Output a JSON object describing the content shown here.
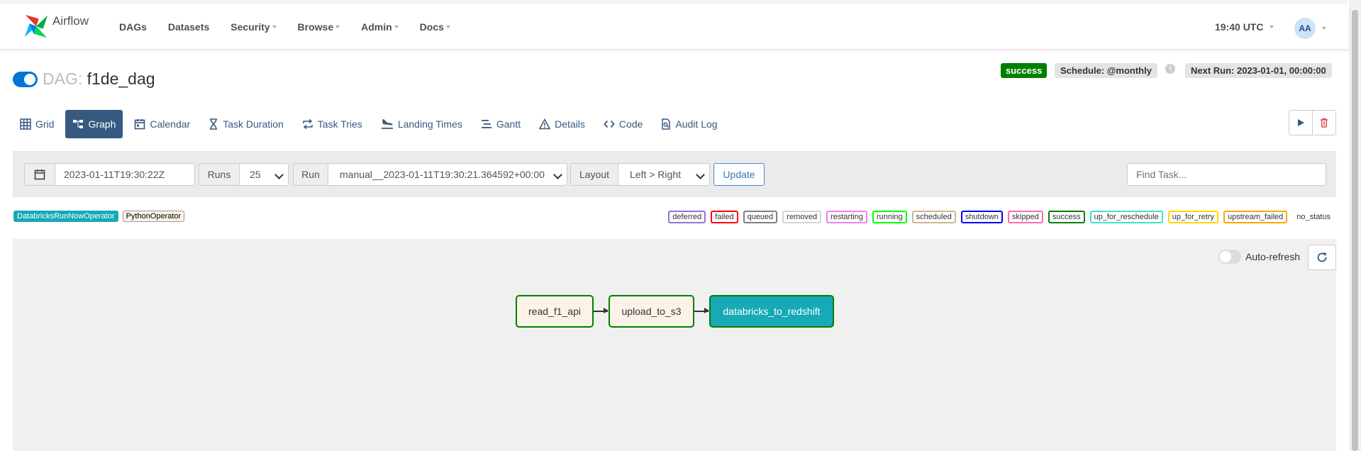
{
  "app": {
    "name": "Airflow"
  },
  "nav": [
    {
      "label": "DAGs",
      "dropdown": false
    },
    {
      "label": "Datasets",
      "dropdown": false
    },
    {
      "label": "Security",
      "dropdown": true
    },
    {
      "label": "Browse",
      "dropdown": true
    },
    {
      "label": "Admin",
      "dropdown": true
    },
    {
      "label": "Docs",
      "dropdown": true
    }
  ],
  "clock": "19:40 UTC",
  "user": {
    "initials": "AA"
  },
  "dag": {
    "label": "DAG:",
    "name": "f1de_dag",
    "paused": false,
    "state": "success",
    "schedule": "Schedule: @monthly",
    "next_run": "Next Run: 2023-01-01, 00:00:00",
    "info": "i"
  },
  "tabs": [
    {
      "label": "Grid",
      "icon": "grid-icon",
      "active": false
    },
    {
      "label": "Graph",
      "icon": "graph-icon",
      "active": true
    },
    {
      "label": "Calendar",
      "icon": "calendar-icon",
      "active": false
    },
    {
      "label": "Task Duration",
      "icon": "hourglass-icon",
      "active": false
    },
    {
      "label": "Task Tries",
      "icon": "retry-icon",
      "active": false
    },
    {
      "label": "Landing Times",
      "icon": "landing-icon",
      "active": false
    },
    {
      "label": "Gantt",
      "icon": "gantt-icon",
      "active": false
    },
    {
      "label": "Details",
      "icon": "warning-triangle-icon",
      "active": false
    },
    {
      "label": "Code",
      "icon": "code-icon",
      "active": false
    },
    {
      "label": "Audit Log",
      "icon": "audit-log-icon",
      "active": false
    }
  ],
  "filters": {
    "base_date": "2023-01-11T19:30:22Z",
    "runs_label": "Runs",
    "runs_value": "25",
    "run_label": "Run",
    "run_value": "manual__2023-01-11T19:30:21.364592+00:00",
    "layout_label": "Layout",
    "layout_value": "Left > Right",
    "update_label": "Update",
    "find_task_placeholder": "Find Task..."
  },
  "operators": [
    {
      "label": "DatabricksRunNowOperator",
      "bg": "#17a9b6",
      "fg": "#ffffff"
    },
    {
      "label": "PythonOperator",
      "bg": "#fdf2e8",
      "fg": "#000000"
    }
  ],
  "states": [
    {
      "label": "deferred",
      "color": "#9470dc"
    },
    {
      "label": "failed",
      "color": "#ff0000"
    },
    {
      "label": "queued",
      "color": "#808080"
    },
    {
      "label": "removed",
      "color": "#d3d3d3"
    },
    {
      "label": "restarting",
      "color": "#ee82ee"
    },
    {
      "label": "running",
      "color": "#00ff00"
    },
    {
      "label": "scheduled",
      "color": "#d2b48c"
    },
    {
      "label": "shutdown",
      "color": "#0000ff"
    },
    {
      "label": "skipped",
      "color": "#ff69b4"
    },
    {
      "label": "success",
      "color": "#008000"
    },
    {
      "label": "up_for_reschedule",
      "color": "#40e0d0"
    },
    {
      "label": "up_for_retry",
      "color": "#ffd700"
    },
    {
      "label": "upstream_failed",
      "color": "#ffa500"
    },
    {
      "label": "no_status",
      "color": ""
    }
  ],
  "graph": {
    "auto_refresh_label": "Auto-refresh",
    "auto_refresh_on": false,
    "nodes": [
      {
        "label": "read_f1_api",
        "operator": "PythonOperator",
        "state": "success"
      },
      {
        "label": "upload_to_s3",
        "operator": "PythonOperator",
        "state": "success"
      },
      {
        "label": "databricks_to_redshift",
        "operator": "DatabricksRunNowOperator",
        "state": "success"
      }
    ]
  }
}
